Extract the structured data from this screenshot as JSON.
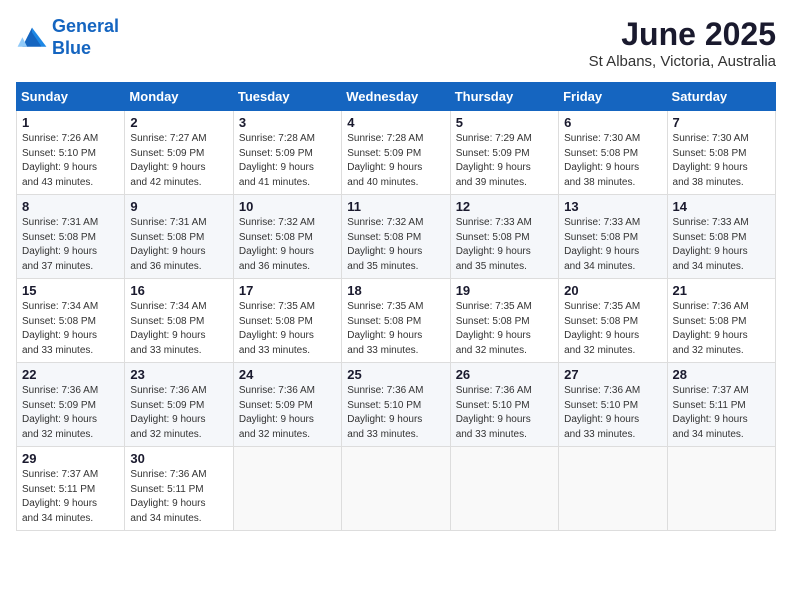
{
  "header": {
    "logo_line1": "General",
    "logo_line2": "Blue",
    "month": "June 2025",
    "location": "St Albans, Victoria, Australia"
  },
  "days_of_week": [
    "Sunday",
    "Monday",
    "Tuesday",
    "Wednesday",
    "Thursday",
    "Friday",
    "Saturday"
  ],
  "weeks": [
    [
      {
        "day": "1",
        "info": "Sunrise: 7:26 AM\nSunset: 5:10 PM\nDaylight: 9 hours\nand 43 minutes."
      },
      {
        "day": "2",
        "info": "Sunrise: 7:27 AM\nSunset: 5:09 PM\nDaylight: 9 hours\nand 42 minutes."
      },
      {
        "day": "3",
        "info": "Sunrise: 7:28 AM\nSunset: 5:09 PM\nDaylight: 9 hours\nand 41 minutes."
      },
      {
        "day": "4",
        "info": "Sunrise: 7:28 AM\nSunset: 5:09 PM\nDaylight: 9 hours\nand 40 minutes."
      },
      {
        "day": "5",
        "info": "Sunrise: 7:29 AM\nSunset: 5:09 PM\nDaylight: 9 hours\nand 39 minutes."
      },
      {
        "day": "6",
        "info": "Sunrise: 7:30 AM\nSunset: 5:08 PM\nDaylight: 9 hours\nand 38 minutes."
      },
      {
        "day": "7",
        "info": "Sunrise: 7:30 AM\nSunset: 5:08 PM\nDaylight: 9 hours\nand 38 minutes."
      }
    ],
    [
      {
        "day": "8",
        "info": "Sunrise: 7:31 AM\nSunset: 5:08 PM\nDaylight: 9 hours\nand 37 minutes."
      },
      {
        "day": "9",
        "info": "Sunrise: 7:31 AM\nSunset: 5:08 PM\nDaylight: 9 hours\nand 36 minutes."
      },
      {
        "day": "10",
        "info": "Sunrise: 7:32 AM\nSunset: 5:08 PM\nDaylight: 9 hours\nand 36 minutes."
      },
      {
        "day": "11",
        "info": "Sunrise: 7:32 AM\nSunset: 5:08 PM\nDaylight: 9 hours\nand 35 minutes."
      },
      {
        "day": "12",
        "info": "Sunrise: 7:33 AM\nSunset: 5:08 PM\nDaylight: 9 hours\nand 35 minutes."
      },
      {
        "day": "13",
        "info": "Sunrise: 7:33 AM\nSunset: 5:08 PM\nDaylight: 9 hours\nand 34 minutes."
      },
      {
        "day": "14",
        "info": "Sunrise: 7:33 AM\nSunset: 5:08 PM\nDaylight: 9 hours\nand 34 minutes."
      }
    ],
    [
      {
        "day": "15",
        "info": "Sunrise: 7:34 AM\nSunset: 5:08 PM\nDaylight: 9 hours\nand 33 minutes."
      },
      {
        "day": "16",
        "info": "Sunrise: 7:34 AM\nSunset: 5:08 PM\nDaylight: 9 hours\nand 33 minutes."
      },
      {
        "day": "17",
        "info": "Sunrise: 7:35 AM\nSunset: 5:08 PM\nDaylight: 9 hours\nand 33 minutes."
      },
      {
        "day": "18",
        "info": "Sunrise: 7:35 AM\nSunset: 5:08 PM\nDaylight: 9 hours\nand 33 minutes."
      },
      {
        "day": "19",
        "info": "Sunrise: 7:35 AM\nSunset: 5:08 PM\nDaylight: 9 hours\nand 32 minutes."
      },
      {
        "day": "20",
        "info": "Sunrise: 7:35 AM\nSunset: 5:08 PM\nDaylight: 9 hours\nand 32 minutes."
      },
      {
        "day": "21",
        "info": "Sunrise: 7:36 AM\nSunset: 5:08 PM\nDaylight: 9 hours\nand 32 minutes."
      }
    ],
    [
      {
        "day": "22",
        "info": "Sunrise: 7:36 AM\nSunset: 5:09 PM\nDaylight: 9 hours\nand 32 minutes."
      },
      {
        "day": "23",
        "info": "Sunrise: 7:36 AM\nSunset: 5:09 PM\nDaylight: 9 hours\nand 32 minutes."
      },
      {
        "day": "24",
        "info": "Sunrise: 7:36 AM\nSunset: 5:09 PM\nDaylight: 9 hours\nand 32 minutes."
      },
      {
        "day": "25",
        "info": "Sunrise: 7:36 AM\nSunset: 5:10 PM\nDaylight: 9 hours\nand 33 minutes."
      },
      {
        "day": "26",
        "info": "Sunrise: 7:36 AM\nSunset: 5:10 PM\nDaylight: 9 hours\nand 33 minutes."
      },
      {
        "day": "27",
        "info": "Sunrise: 7:36 AM\nSunset: 5:10 PM\nDaylight: 9 hours\nand 33 minutes."
      },
      {
        "day": "28",
        "info": "Sunrise: 7:37 AM\nSunset: 5:11 PM\nDaylight: 9 hours\nand 34 minutes."
      }
    ],
    [
      {
        "day": "29",
        "info": "Sunrise: 7:37 AM\nSunset: 5:11 PM\nDaylight: 9 hours\nand 34 minutes."
      },
      {
        "day": "30",
        "info": "Sunrise: 7:36 AM\nSunset: 5:11 PM\nDaylight: 9 hours\nand 34 minutes."
      },
      {
        "day": "",
        "info": ""
      },
      {
        "day": "",
        "info": ""
      },
      {
        "day": "",
        "info": ""
      },
      {
        "day": "",
        "info": ""
      },
      {
        "day": "",
        "info": ""
      }
    ]
  ]
}
